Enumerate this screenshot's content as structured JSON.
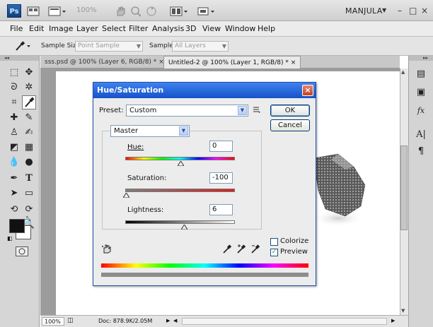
{
  "app": {
    "logo": "Ps",
    "zoom": "100%",
    "workspace": "MANJULA",
    "window_controls": [
      "–",
      "□",
      "×"
    ]
  },
  "menu": [
    "File",
    "Edit",
    "Image",
    "Layer",
    "Select",
    "Filter",
    "Analysis",
    "3D",
    "View",
    "Window",
    "Help"
  ],
  "options": {
    "sample_size_label": "Sample Size:",
    "sample_size_value": "Point Sample",
    "sample_label": "Sample:",
    "sample_value": "All Layers"
  },
  "tabs": [
    {
      "label": "sss.psd @ 100% (Layer 6, RGB/8) *",
      "close": "×",
      "active": false
    },
    {
      "label": "Untitled-2 @ 100% (Layer 1, RGB/8) *",
      "close": "×",
      "active": true
    }
  ],
  "dialog": {
    "title": "Hue/Saturation",
    "close": "×",
    "preset_label": "Preset:",
    "preset_value": "Custom",
    "channel_value": "Master",
    "ok_label": "OK",
    "cancel_label": "Cancel",
    "hue_label": "Hue:",
    "hue_value": "0",
    "saturation_label": "Saturation:",
    "saturation_value": "-100",
    "lightness_label": "Lightness:",
    "lightness_value": "6",
    "colorize_label": "Colorize",
    "colorize_checked": false,
    "preview_label": "Preview",
    "preview_checked": true,
    "preview_mark": "✓"
  },
  "status": {
    "zoom": "100%",
    "doc_info": "Doc: 878.9K/2.05M"
  },
  "colors": {
    "foreground": "#111111",
    "background": "#ffffff",
    "title_bar": "#1f5fd6",
    "accent": "#2b6bb5"
  }
}
